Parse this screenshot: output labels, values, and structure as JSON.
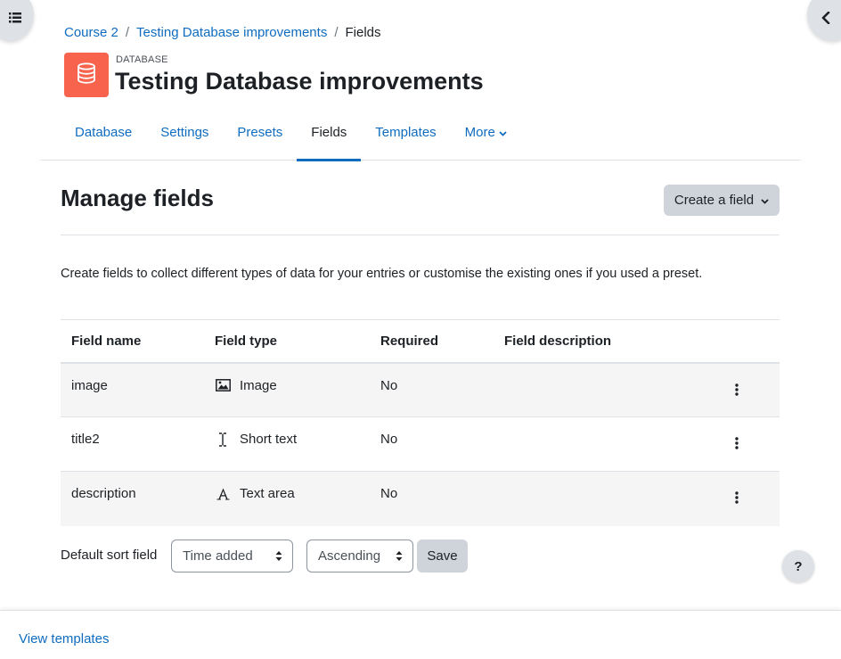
{
  "breadcrumb": {
    "items": [
      "Course 2",
      "Testing Database improvements",
      "Fields"
    ],
    "separator": "/"
  },
  "header": {
    "module_type": "DATABASE",
    "title": "Testing Database improvements",
    "icon": "database-icon",
    "icon_color": "#f7634d"
  },
  "secondary_nav": {
    "tabs": [
      {
        "label": "Database"
      },
      {
        "label": "Settings"
      },
      {
        "label": "Presets"
      },
      {
        "label": "Fields",
        "active": true
      },
      {
        "label": "Templates"
      },
      {
        "label": "More"
      }
    ]
  },
  "main": {
    "heading": "Manage fields",
    "create_button": "Create a field",
    "intro": "Create fields to collect different types of data for your entries or customise the existing ones if you used a preset.",
    "table": {
      "headers": [
        "Field name",
        "Field type",
        "Required",
        "Field description"
      ],
      "rows": [
        {
          "name": "image",
          "type": "Image",
          "type_icon": "image-icon",
          "required": "No",
          "description": ""
        },
        {
          "name": "title2",
          "type": "Short text",
          "type_icon": "text-cursor-icon",
          "required": "No",
          "description": ""
        },
        {
          "name": "description",
          "type": "Text area",
          "type_icon": "font-icon",
          "required": "No",
          "description": ""
        }
      ]
    },
    "sort": {
      "label": "Default sort field",
      "field_selected": "Time added",
      "direction_selected": "Ascending",
      "save_label": "Save"
    }
  },
  "help_button": "?",
  "footer": {
    "link": "View templates"
  },
  "colors": {
    "link": "#0f6cbf",
    "text": "#1d2125",
    "button_secondary": "#ced4da",
    "row_stripe": "#f5f5f5"
  }
}
